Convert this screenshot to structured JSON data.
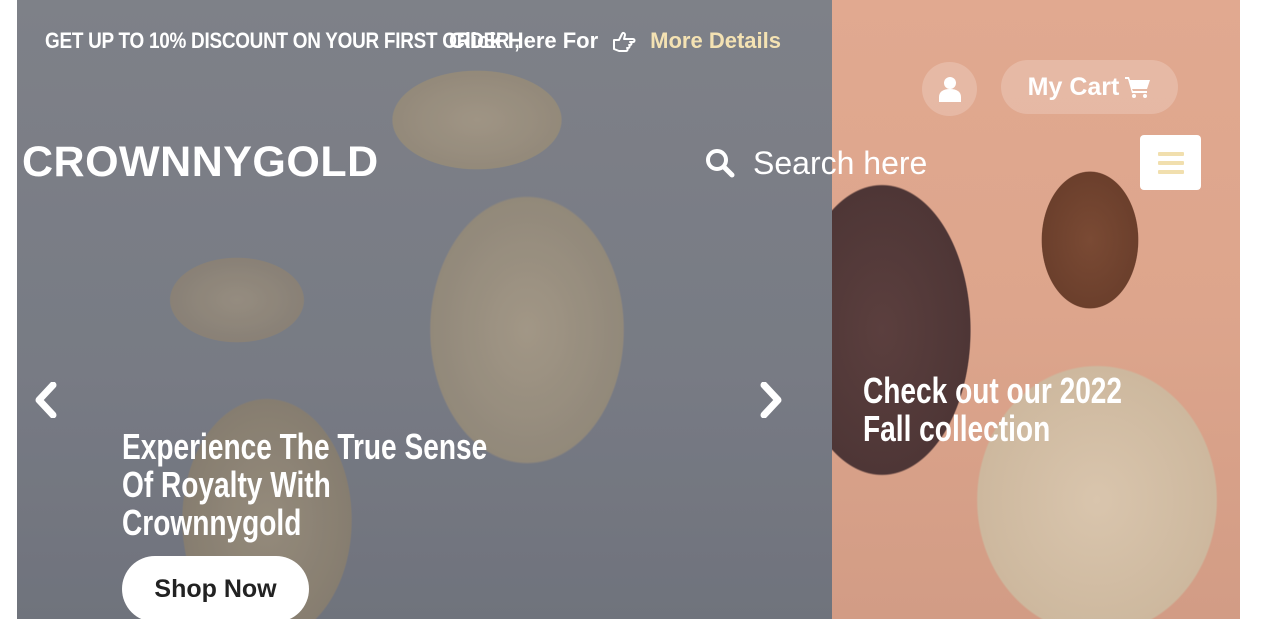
{
  "announcement": {
    "promo_text": "GET UP TO 10% DISCOUNT ON YOUR FIRST ORDER ,",
    "click_text": "Click Here For",
    "hand_icon": "hand-pointing-right-icon",
    "more_link": "More Details",
    "more_color": "#f4e2b3"
  },
  "header": {
    "logo": "CROWNNYGOLD",
    "user_icon": "user-icon",
    "cart_label": "My Cart",
    "cart_icon": "shopping-cart-icon",
    "search": {
      "icon": "search-icon",
      "placeholder": "Search here"
    },
    "menu_icon": "hamburger-menu-icon",
    "accent_color": "#f1dfae"
  },
  "slider": {
    "prev_icon": "chevron-left-icon",
    "next_icon": "chevron-right-icon",
    "slides": [
      {
        "caption": "Experience The True Sense Of Royalty With Crownnygold",
        "button": "Shop Now"
      },
      {
        "caption": "Check out our 2022 Fall collection"
      }
    ]
  }
}
